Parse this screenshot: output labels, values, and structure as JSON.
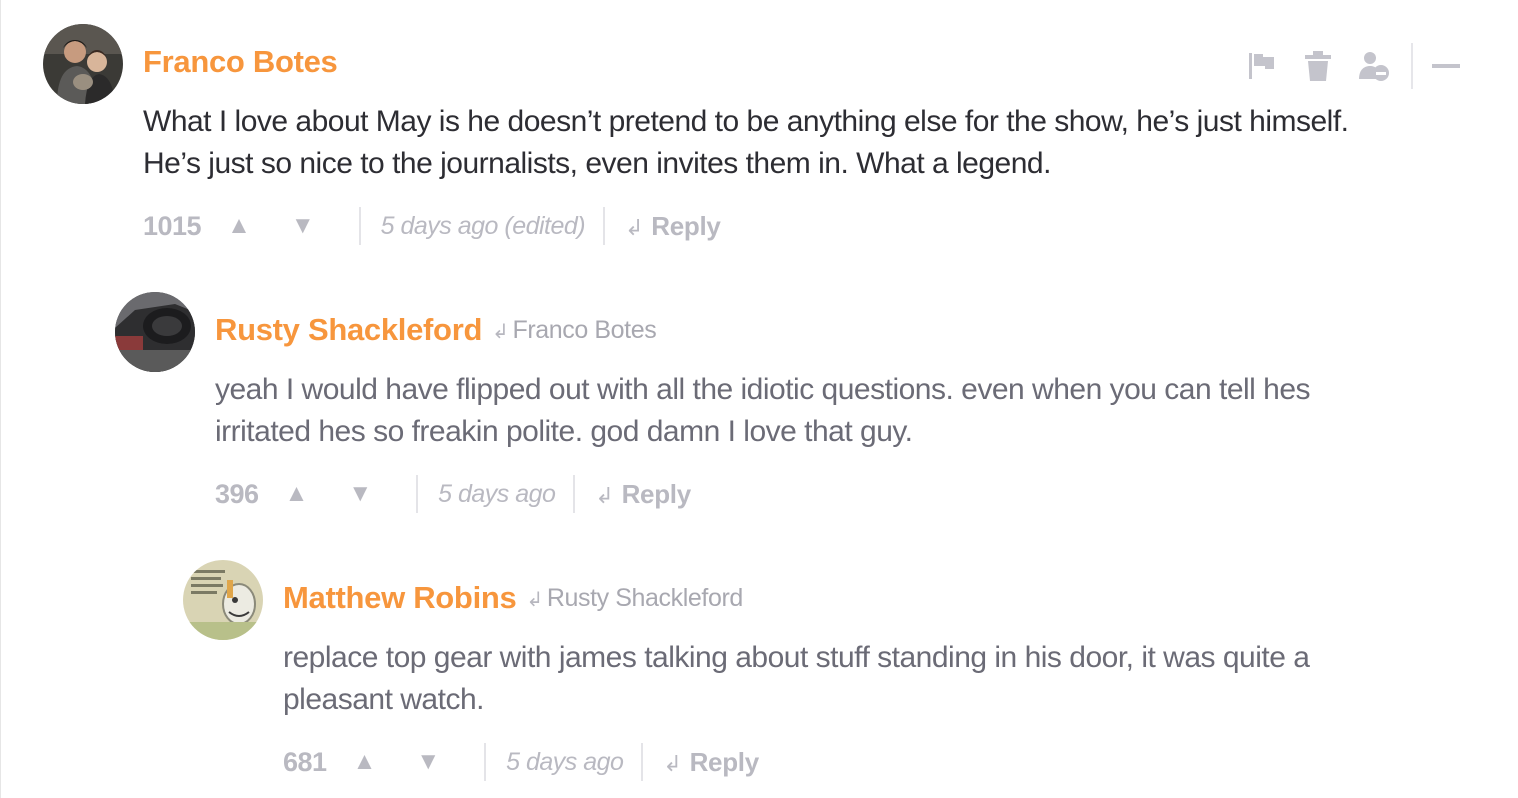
{
  "comments": [
    {
      "author": "Franco Botes",
      "reply_to": "",
      "text_lines": [
        "What I love about May is he doesn’t pretend to be anything else for the show, he’s just himself.",
        "He’s just so nice to the journalists, even invites them in. What a legend."
      ],
      "score": "1015",
      "time": "5 days ago (edited)",
      "reply_label": "Reply",
      "avatar_icon": "user-photo-avatar"
    },
    {
      "author": "Rusty Shackleford",
      "reply_to": "Franco Botes",
      "text_lines": [
        "yeah I would have flipped out with all the idiotic questions. even when you can tell hes",
        "irritated hes so freakin polite. god damn I love that guy."
      ],
      "score": "396",
      "time": "5 days ago",
      "reply_label": "Reply",
      "avatar_icon": "car-photo-avatar"
    },
    {
      "author": "Matthew Robins",
      "reply_to": "Rusty Shackleford",
      "text_lines": [
        "replace top gear with james talking about stuff standing in his door, it was quite a",
        "pleasant watch."
      ],
      "score": "681",
      "time": "5 days ago",
      "reply_label": "Reply",
      "avatar_icon": "comic-photo-avatar"
    }
  ],
  "toolbar_icons": [
    "flag-icon",
    "trash-icon",
    "block-user-icon",
    "collapse-icon"
  ],
  "glyphs": {
    "upvote": "▲",
    "downvote": "▼",
    "reply_arrow": "↲"
  },
  "colors": {
    "author": "#f7963d",
    "muted": "#b9b9c1",
    "root_text": "#2d2d33",
    "nested_text": "#6b6b76"
  }
}
